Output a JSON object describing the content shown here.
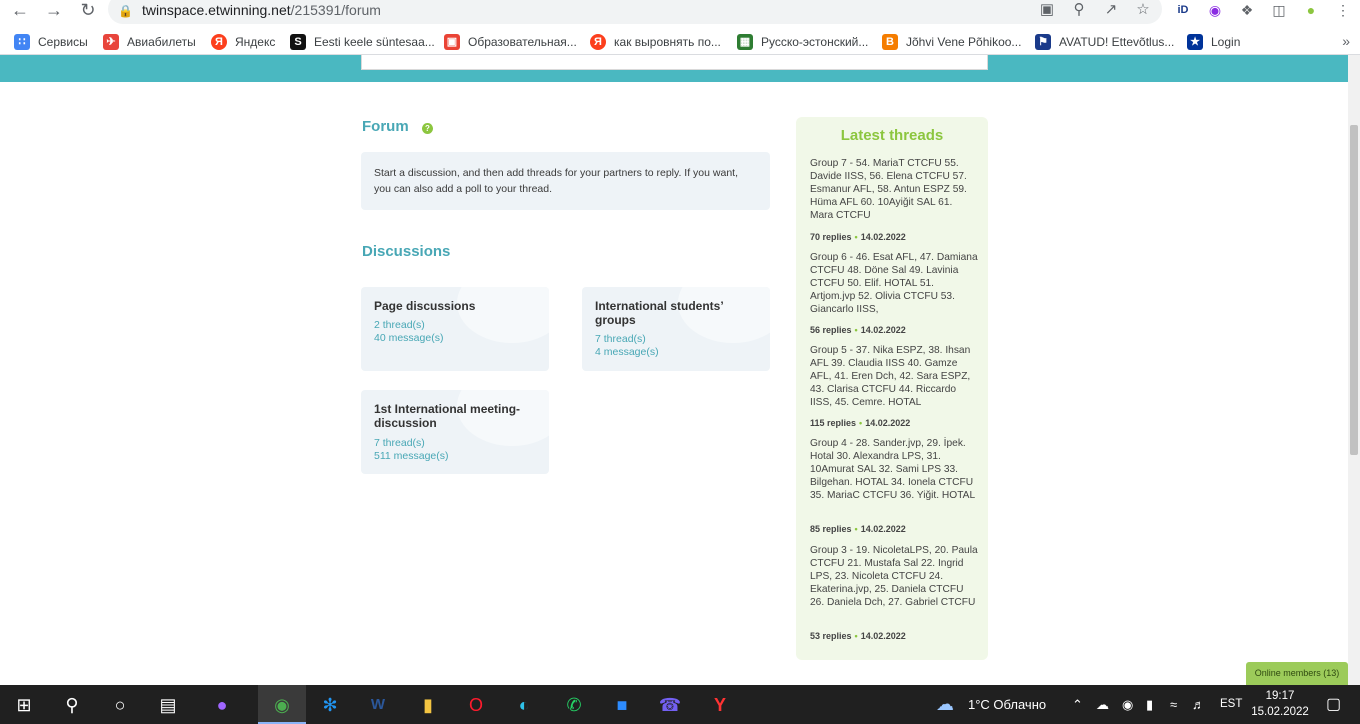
{
  "browser": {
    "url_host": "twinspace.etwinning.net",
    "url_path": "/215391/forum"
  },
  "bookmarks": [
    {
      "label": "Сервисы",
      "icon": "apps-grid-icon",
      "color": "#4285f4"
    },
    {
      "label": "Авиабилеты",
      "icon": "plane-icon",
      "color": "#e8453c"
    },
    {
      "label": "Яндекс",
      "icon": "yandex-icon",
      "color": "#fc3f1d"
    },
    {
      "label": "Eesti keele süntesaa...",
      "icon": "es-icon",
      "color": "#111111"
    },
    {
      "label": "Образовательная...",
      "icon": "briefcase-icon",
      "color": "#ea4335"
    },
    {
      "label": "как выровнять по...",
      "icon": "yandex-icon",
      "color": "#fc3f1d"
    },
    {
      "label": "Русско-эстонский...",
      "icon": "grid-icon",
      "color": "#2e7d32"
    },
    {
      "label": "Jõhvi Vene Põhikoo...",
      "icon": "blogger-icon",
      "color": "#f57d00"
    },
    {
      "label": "AVATUD! Ettevõtlus...",
      "icon": "flag-icon",
      "color": "#1a3a8a"
    },
    {
      "label": "Login",
      "icon": "eu-flag-icon",
      "color": "#003399"
    }
  ],
  "forum": {
    "title": "Forum",
    "help_symbol": "?",
    "intro": "Start a discussion, and then add threads for your partners to reply. If you want, you can also add a poll to your thread."
  },
  "discussions": {
    "title": "Discussions",
    "cards": [
      {
        "title": "Page discussions",
        "threads": "2 thread(s)",
        "messages": "40 message(s)"
      },
      {
        "title": "International students’ groups",
        "threads": "7 thread(s)",
        "messages": "4 message(s)"
      },
      {
        "title": "1st International meeting-discussion",
        "threads": "7 thread(s)",
        "messages": "511 message(s)"
      }
    ]
  },
  "latest_threads": {
    "title": "Latest threads",
    "items": [
      {
        "text": "Group 7 - 54. MariaT CTCFU 55. Davide IISS, 56. Elena CTCFU 57. Esmanur AFL, 58. Antun ESPZ 59. Hüma AFL 60. 10Ayiğit SAL 61. Mara CTCFU",
        "replies": "70 replies",
        "date": "14.02.2022"
      },
      {
        "text": "Group 6 - 46. Esat AFL, 47. Damiana CTCFU 48. Döne Sal 49. Lavinia CTCFU 50. Elif. HOTAL 51. Artjom.jvp 52. Olivia CTCFU 53. Giancarlo IISS,",
        "replies": "56 replies",
        "date": "14.02.2022"
      },
      {
        "text": "Group 5 - 37. Nika ESPZ, 38. Ihsan AFL 39. Claudia IISS 40. Gamze AFL, 41. Eren Dch, 42. Sara ESPZ, 43. Clarisa CTCFU 44. Riccardo IISS, 45. Cemre. HOTAL",
        "replies": "115 replies",
        "date": "14.02.2022"
      },
      {
        "text": "Group 4 - 28. Sander.jvp, 29. İpek. Hotal 30. Alexandra LPS, 31. 10Amurat SAL 32. Sami LPS 33. Bilgehan. HOTAL 34. Ionela CTCFU 35. MariaC CTCFU 36. Yiğit. HOTAL",
        "replies": "85 replies",
        "date": "14.02.2022"
      },
      {
        "text": "Group 3 - 19. NicoletaLPS, 20. Paula CTCFU 21. Mustafa Sal 22. Ingrid LPS, 23. Nicoleta CTCFU 24. Ekaterina.jvp, 25. Daniela CTCFU 26. Daniela Dch, 27. Gabriel CTCFU",
        "replies": "53 replies",
        "date": "14.02.2022"
      }
    ]
  },
  "online_members": "Online members (13)",
  "taskbar": {
    "weather": "1°C  Облачно",
    "language": "EST",
    "time": "19:17",
    "date": "15.02.2022"
  }
}
